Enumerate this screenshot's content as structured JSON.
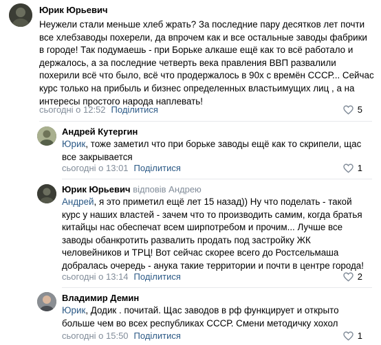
{
  "comments": [
    {
      "author": "Юрик Юрьевич",
      "reply_to": "",
      "mention": "",
      "lines": [
        "Неужели стали меньше хлеб жрать? За последние пару десятков лет почти",
        "все хлебзаводы похерели, да впрочем как и все остальные заводы фабрики",
        "в городе! Так подумаешь - при Борьке алкаше ещё как то всё работало и",
        "держалось, а за последние четверть века правления ВВП развалили",
        "похерили всё что было, всё что продержалось в 90х с времён СССР... Сейчас",
        "курс только на прибыль и бизнес определенных властьимущих лиц , а на",
        "интересы простого народа наплевать!"
      ],
      "time": "сьогодні о 12:52",
      "share": "Поділитися",
      "likes": "5"
    },
    {
      "author": "Андрей Кутергин",
      "reply_to": "",
      "mention": "Юрик",
      "lines": [
        ", тоже заметил что при борьке заводы ещё как то скрипели, щас",
        "все закрывается"
      ],
      "time": "сьогодні о 13:01",
      "share": "Поділитися",
      "likes": "1"
    },
    {
      "author": "Юрик Юрьевич",
      "reply_to": "відповів Андрею",
      "mention": "Андрей",
      "lines": [
        ", я это приметил ещё лет 15 назад)) Ну что поделать - такой",
        "курс у наших властей - зачем что то производить самим, когда братья",
        "китайцы нас обеспечат всем ширпотребом и прочим... Лучше все",
        "заводы обанкротить развалить продать под застройку ЖК",
        "человейников и ТРЦ! Вот сейчас скорее всего до Ростсельмаша",
        "добралась очередь - анука такие территории и почти в центре города!"
      ],
      "time": "сьогодні о 13:14",
      "share": "Поділитися",
      "likes": "2"
    },
    {
      "author": "Владимир Демин",
      "reply_to": "",
      "mention": "Юрик",
      "lines": [
        ", Додик . почитай. Щас заводов в рф функцирует и открыто",
        "больше чем во всех республиках СССР. Смени методичку хохол"
      ],
      "time": "сьогодні о 15:50",
      "share": "Поділитися",
      "likes": "1"
    }
  ],
  "icons": {
    "like": "heart-outline-icon"
  },
  "colors": {
    "link": "#2a5885",
    "meta": "#818c99",
    "divider": "#e7e8ec"
  }
}
